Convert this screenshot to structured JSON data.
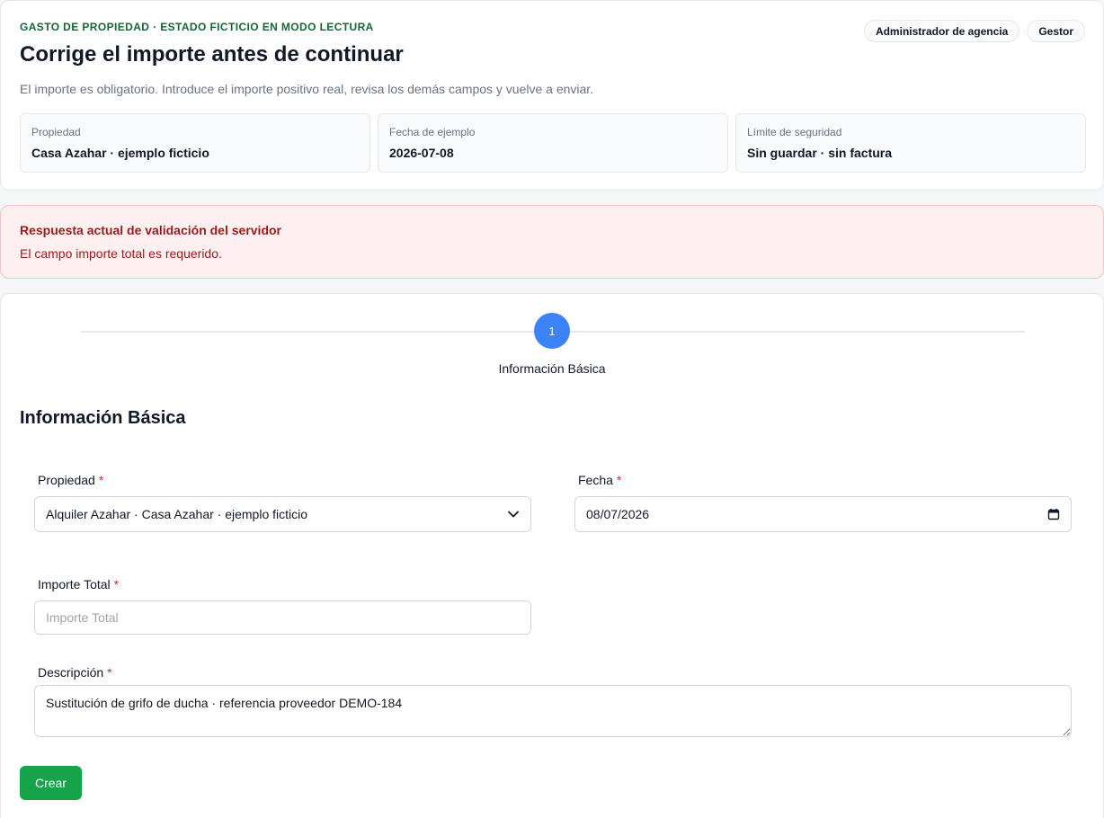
{
  "header": {
    "eyebrow": "GASTO DE PROPIEDAD · ESTADO FICTICIO EN MODO LECTURA",
    "title": "Corrige el importe antes de continuar",
    "subtitle": "El importe es obligatorio. Introduce el importe positivo real, revisa los demás campos y vuelve a enviar.",
    "roles": [
      "Administrador de agencia",
      "Gestor"
    ],
    "info": [
      {
        "label": "Propiedad",
        "value": "Casa Azahar · ejemplo ficticio"
      },
      {
        "label": "Fecha de ejemplo",
        "value": "2026-07-08"
      },
      {
        "label": "Límite de seguridad",
        "value": "Sin guardar · sin factura"
      }
    ]
  },
  "alert": {
    "title": "Respuesta actual de validación del servidor",
    "message": "El campo importe total es requerido."
  },
  "stepper": {
    "step_number": "1",
    "step_label": "Información Básica"
  },
  "form": {
    "section_title": "Información Básica",
    "required_mark": "*",
    "property": {
      "label": "Propiedad",
      "value": "Alquiler Azahar · Casa Azahar · ejemplo ficticio"
    },
    "date": {
      "label": "Fecha",
      "value": "08/07/2026"
    },
    "amount": {
      "label": "Importe Total",
      "value": "",
      "placeholder": "Importe Total"
    },
    "description": {
      "label": "Descripción",
      "value": "Sustitución de grifo de ducha · referencia proveedor DEMO-184"
    },
    "submit_label": "Crear"
  },
  "icons": {
    "select": "chevron-down-icon",
    "date": "calendar-icon"
  },
  "colors": {
    "accent": "#3b82f6",
    "success": "#16a34a",
    "error": "#991b1b",
    "eyebrow": "#166534"
  }
}
